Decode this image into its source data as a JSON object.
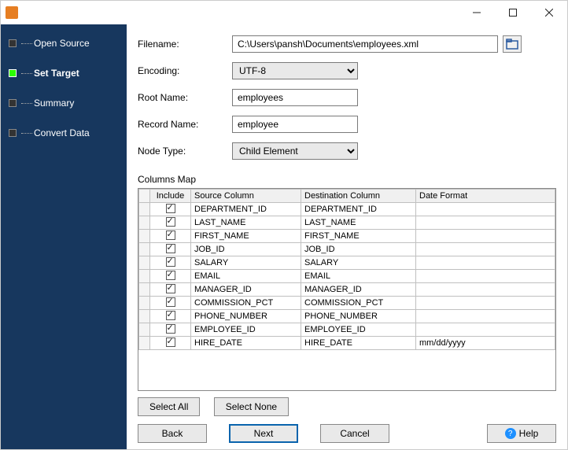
{
  "nav": {
    "open_source": "Open Source",
    "set_target": "Set Target",
    "summary": "Summary",
    "convert_data": "Convert Data"
  },
  "form": {
    "filename_label": "Filename:",
    "filename_value": "C:\\Users\\pansh\\Documents\\employees.xml",
    "encoding_label": "Encoding:",
    "encoding_value": "UTF-8",
    "root_label": "Root Name:",
    "root_value": "employees",
    "record_label": "Record Name:",
    "record_value": "employee",
    "node_label": "Node Type:",
    "node_value": "Child Element"
  },
  "columns_map_label": "Columns Map",
  "headers": {
    "include": "Include",
    "source": "Source Column",
    "dest": "Destination Column",
    "datefmt": "Date Format"
  },
  "rows": [
    {
      "src": "DEPARTMENT_ID",
      "dst": "DEPARTMENT_ID",
      "fmt": ""
    },
    {
      "src": "LAST_NAME",
      "dst": "LAST_NAME",
      "fmt": ""
    },
    {
      "src": "FIRST_NAME",
      "dst": "FIRST_NAME",
      "fmt": ""
    },
    {
      "src": "JOB_ID",
      "dst": "JOB_ID",
      "fmt": ""
    },
    {
      "src": "SALARY",
      "dst": "SALARY",
      "fmt": ""
    },
    {
      "src": "EMAIL",
      "dst": "EMAIL",
      "fmt": ""
    },
    {
      "src": "MANAGER_ID",
      "dst": "MANAGER_ID",
      "fmt": ""
    },
    {
      "src": "COMMISSION_PCT",
      "dst": "COMMISSION_PCT",
      "fmt": ""
    },
    {
      "src": "PHONE_NUMBER",
      "dst": "PHONE_NUMBER",
      "fmt": ""
    },
    {
      "src": "EMPLOYEE_ID",
      "dst": "EMPLOYEE_ID",
      "fmt": ""
    },
    {
      "src": "HIRE_DATE",
      "dst": "HIRE_DATE",
      "fmt": "mm/dd/yyyy"
    }
  ],
  "buttons": {
    "select_all": "Select All",
    "select_none": "Select None",
    "back": "Back",
    "next": "Next",
    "cancel": "Cancel",
    "help": "Help"
  }
}
